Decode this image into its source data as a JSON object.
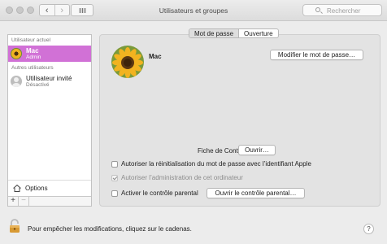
{
  "window": {
    "title": "Utilisateurs et groupes",
    "back_glyph": "‹",
    "forward_glyph": "›",
    "search_placeholder": "Rechercher"
  },
  "sidebar": {
    "current_user_header": "Utilisateur actuel",
    "current_user": {
      "name": "Mac",
      "role": "Admin",
      "selected": true
    },
    "other_users_header": "Autres utilisateurs",
    "other_users": [
      {
        "name": "Utilisateur invité",
        "role": "Désactivé"
      }
    ],
    "options_label": "Options",
    "add_glyph": "+",
    "remove_glyph": "−"
  },
  "main": {
    "tabs": [
      {
        "label": "Mot de passe",
        "active": true
      },
      {
        "label": "Ouverture",
        "active": false
      }
    ],
    "user_name": "Mac",
    "change_password_button": "Modifier le mot de passe…",
    "contacts_label": "Fiche de Contacts :",
    "contacts_open_button": "Ouvrir…",
    "checkboxes": [
      {
        "label": "Autoriser la réinitialisation du mot de passe avec l’identifiant Apple",
        "checked": false,
        "enabled": true
      },
      {
        "label": "Autoriser l’administration de cet ordinateur",
        "checked": true,
        "enabled": false
      },
      {
        "label": "Activer le contrôle parental",
        "checked": false,
        "enabled": true
      }
    ],
    "parental_controls_button": "Ouvrir le contrôle parental…"
  },
  "footer": {
    "lock_text": "Pour empêcher les modifications, cliquez sur le cadenas.",
    "help_glyph": "?"
  },
  "colors": {
    "selection": "#d171d6",
    "window_bg": "#ececec",
    "panel_bg": "#e3e3e3"
  }
}
